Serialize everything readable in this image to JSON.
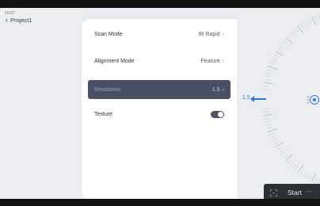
{
  "status_bar": {
    "time": "16:07"
  },
  "header": {
    "back_label": "Project1"
  },
  "settings": {
    "scan_mode": {
      "label": "Scan Mode",
      "value": "IR Rapid"
    },
    "alignment_mode": {
      "label": "Alignment Mode",
      "value": "Feature"
    },
    "resolution": {
      "label": "Resolution",
      "value": "1.5"
    },
    "texture": {
      "label": "Texture",
      "enabled": false
    }
  },
  "dial": {
    "value": "1.5"
  },
  "actions": {
    "start_label": "Start"
  },
  "colors": {
    "accent": "#2a7bd8",
    "selected_row": "#4a5064",
    "start_button": "#2c2f36"
  },
  "icons": [
    "chevron-left-icon",
    "chevron-right-icon",
    "toggle-switch",
    "scan-icon",
    "dial-pointer-icon",
    "circle-control-icon"
  ]
}
